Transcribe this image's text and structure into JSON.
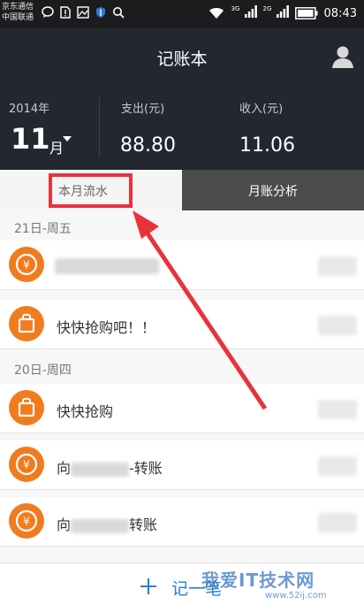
{
  "statusbar": {
    "carrier_line1": "京东通信",
    "carrier_line2": "中国联通",
    "signal1_label": "3G",
    "signal2_label": "2G",
    "time": "08:43"
  },
  "appbar": {
    "title": "记账本",
    "avatar_icon": "user-icon"
  },
  "summary": {
    "year": "2014年",
    "month": "11",
    "month_unit": "月",
    "expense_label": "支出(元)",
    "expense_value": "88.80",
    "income_label": "收入(元)",
    "income_value": "11.06"
  },
  "tabs": {
    "monthly": "本月流水",
    "analysis": "月账分析"
  },
  "list": {
    "groups": [
      {
        "day": "21日-周五",
        "items": [
          {
            "icon": "yuan-coin-icon",
            "title": ""
          },
          {
            "icon": "shopping-bag-icon",
            "title": "快快抢购吧！！"
          }
        ]
      },
      {
        "day": "20日-周四",
        "items": [
          {
            "icon": "shopping-bag-icon",
            "title": "快快抢购"
          },
          {
            "icon": "yuan-coin-icon",
            "title_prefix": "向",
            "title_suffix": "-转账"
          },
          {
            "icon": "yuan-coin-icon",
            "title_prefix": "向",
            "title_suffix": "转账"
          }
        ]
      }
    ]
  },
  "bottombar": {
    "add_label": "记一笔"
  },
  "watermark": {
    "main": "我爱IT技术网",
    "sub": "www.52ij.com"
  },
  "colors": {
    "header_bg": "#222730",
    "accent_orange": "#f07c1f",
    "highlight_red": "#e8323c",
    "link_blue": "#2b7fd2"
  }
}
